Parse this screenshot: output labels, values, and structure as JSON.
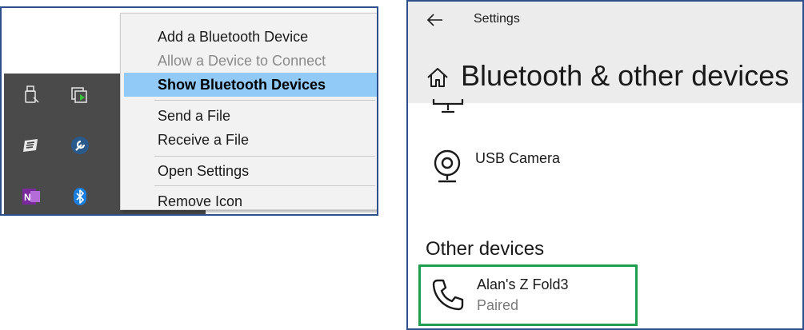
{
  "tray": {
    "icons": [
      "usb-drive-icon",
      "devices-play-icon",
      "sync-app-icon",
      "wrench-tool-icon",
      "onenote-icon",
      "bluetooth-icon"
    ]
  },
  "context_menu": {
    "items": [
      {
        "label": "Add a Bluetooth Device",
        "state": "normal"
      },
      {
        "label": "Allow a Device to Connect",
        "state": "disabled"
      },
      {
        "label": "Show Bluetooth Devices",
        "state": "highlighted"
      },
      {
        "label": "Send a File",
        "state": "normal"
      },
      {
        "label": "Receive a File",
        "state": "normal"
      },
      {
        "label": "Open Settings",
        "state": "normal"
      },
      {
        "label": "Remove Icon",
        "state": "normal"
      }
    ],
    "highlight_color": "#91c9f7"
  },
  "settings": {
    "window_title": "Settings",
    "page_title": "Bluetooth & other devices",
    "devices": [
      {
        "name": "USB Camera",
        "icon": "webcam-icon"
      }
    ],
    "other_devices": {
      "heading": "Other devices",
      "items": [
        {
          "name": "Alan's Z Fold3",
          "status": "Paired",
          "icon": "phone-icon"
        }
      ]
    },
    "highlight_border_color": "#1f9e52"
  }
}
